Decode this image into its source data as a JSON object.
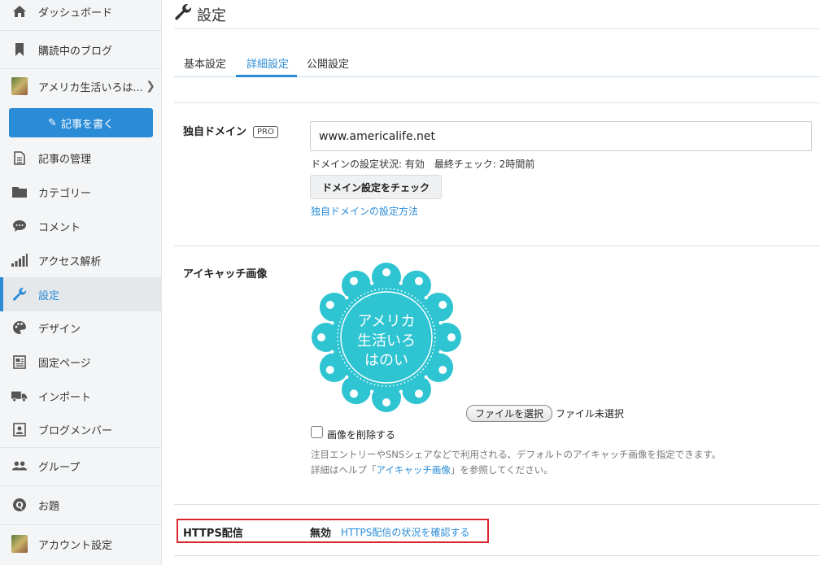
{
  "sidebar": {
    "items": [
      {
        "label": "ダッシュボード",
        "icon": "home-icon"
      },
      {
        "label": "購読中のブログ",
        "icon": "bookmark-icon"
      },
      {
        "label": "アメリカ生活いろは...",
        "icon": "blog-thumbnail"
      },
      {
        "label": "記事の管理",
        "icon": "document-icon"
      },
      {
        "label": "カテゴリー",
        "icon": "folder-icon"
      },
      {
        "label": "コメント",
        "icon": "comment-icon"
      },
      {
        "label": "アクセス解析",
        "icon": "bar-chart-icon"
      },
      {
        "label": "設定",
        "icon": "wrench-icon"
      },
      {
        "label": "デザイン",
        "icon": "palette-icon"
      },
      {
        "label": "固定ページ",
        "icon": "page-icon"
      },
      {
        "label": "インポート",
        "icon": "truck-icon"
      },
      {
        "label": "ブログメンバー",
        "icon": "members-icon"
      },
      {
        "label": "グループ",
        "icon": "group-icon"
      },
      {
        "label": "お題",
        "icon": "question-icon"
      },
      {
        "label": "アカウント設定",
        "icon": "account-thumbnail"
      }
    ],
    "write_button": "記事を書く",
    "accent": "#2a8bd6"
  },
  "header": {
    "title": "設定"
  },
  "tabs": [
    {
      "label": "基本設定"
    },
    {
      "label": "詳細設定",
      "active": true
    },
    {
      "label": "公開設定"
    }
  ],
  "domain": {
    "label": "独自ドメイン",
    "badge": "PRO",
    "value": "www.americalife.net",
    "status": "ドメインの設定状況: 有効　最終チェック: 2時間前",
    "check_button": "ドメイン設定をチェック",
    "howto_link": "独自ドメインの設定方法"
  },
  "eyecatch": {
    "label": "アイキャッチ画像",
    "image_text": [
      "アメリカ",
      "生活いろ",
      "はのい"
    ],
    "image_color": "#2ec4d2",
    "file_button": "ファイルを選択",
    "file_status": "ファイル未選択",
    "delete_label": "画像を削除する",
    "help_line1": "注目エントリーやSNSシェアなどで利用される、デフォルトのアイキャッチ画像を指定できます。",
    "help_prefix": "詳細はヘルプ「",
    "help_link": "アイキャッチ画像",
    "help_suffix": "」を参照してください。"
  },
  "https": {
    "label": "HTTPS配信",
    "status": "無効",
    "link": "HTTPS配信の状況を確認する",
    "highlight_color": "#d8262f"
  }
}
